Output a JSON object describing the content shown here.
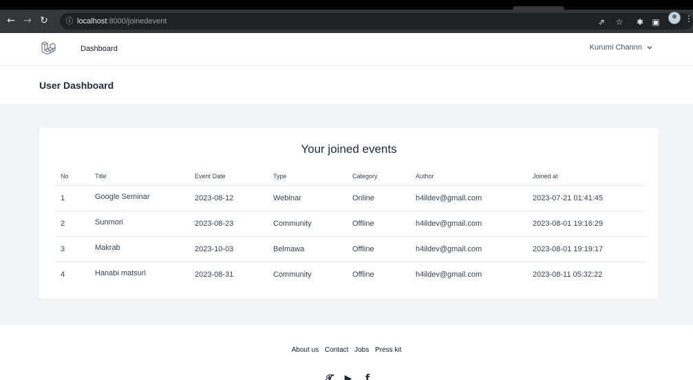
{
  "browser": {
    "back_icon": "arrow-left-icon",
    "forward_icon": "arrow-right-icon",
    "reload_icon": "reload-icon",
    "url_host": "localhost",
    "url_rest": ":8000/joinedevent"
  },
  "nav": {
    "dashboard_label": "Dashboard",
    "user_name": "Kurumi Channn"
  },
  "header": {
    "title": "User Dashboard"
  },
  "events": {
    "title": "Your joined events",
    "columns": {
      "no": "No",
      "title": "Title",
      "event_date": "Event Date",
      "type": "Type",
      "category": "Category",
      "author": "Author",
      "joined_at": "Joined at"
    },
    "rows": [
      {
        "no": "1",
        "title": "Google Seminar",
        "event_date": "2023-08-12",
        "type": "Webinar",
        "category": "Online",
        "author": "h4ildev@gmail.com",
        "joined_at": "2023-07-21 01:41:45"
      },
      {
        "no": "2",
        "title": "Sunmori",
        "event_date": "2023-08-23",
        "type": "Community",
        "category": "Offline",
        "author": "h4ildev@gmail.com",
        "joined_at": "2023-08-01 19:16:29"
      },
      {
        "no": "3",
        "title": "Makrab",
        "event_date": "2023-10-03",
        "type": "Belmawa",
        "category": "Offline",
        "author": "h4ildev@gmail.com",
        "joined_at": "2023-08-01 19:19:17"
      },
      {
        "no": "4",
        "title": "Hanabi matsuri",
        "event_date": "2023-08-31",
        "type": "Community",
        "category": "Offline",
        "author": "h4ildev@gmail.com",
        "joined_at": "2023-08-11 05:32:22"
      }
    ]
  },
  "footer": {
    "links": [
      "About us",
      "Contact",
      "Jobs",
      "Press kit"
    ]
  },
  "colors": {
    "page_bg": "#f3f4f6",
    "text": "#374151",
    "chrome_bg": "#35363a"
  }
}
